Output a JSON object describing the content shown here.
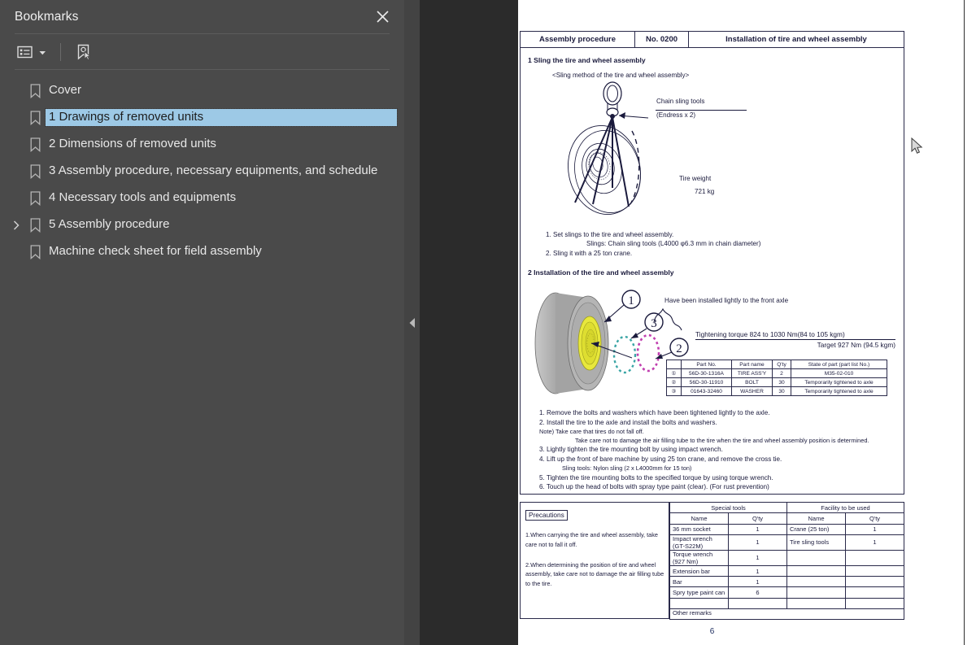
{
  "sidebar": {
    "title": "Bookmarks",
    "close_icon": "close-icon",
    "toolbar": {
      "options_label": "list-options-dropdown",
      "new_bookmark_label": "new-bookmark-icon"
    },
    "items": [
      {
        "label": "Cover",
        "selected": false,
        "expandable": false
      },
      {
        "label": "1 Drawings of removed units",
        "selected": true,
        "expandable": false
      },
      {
        "label": "2 Dimensions of removed units",
        "selected": false,
        "expandable": false
      },
      {
        "label": "3 Assembly procedure, necessary equipments, and schedule",
        "selected": false,
        "expandable": false
      },
      {
        "label": "4 Necessary tools and equipments",
        "selected": false,
        "expandable": false
      },
      {
        "label": "5 Assembly procedure",
        "selected": false,
        "expandable": true
      },
      {
        "label": "Machine check sheet for field assembly",
        "selected": false,
        "expandable": false
      }
    ]
  },
  "panel": {
    "collapse_handle": "collapse-panel-arrow"
  },
  "document": {
    "header": {
      "col1": "Assembly procedure",
      "col2": "No. 0200",
      "col3": "Installation of tire and wheel assembly"
    },
    "section1": {
      "title": "1 Sling the tire and wheel assembly",
      "subtitle": "<Sling method of the tire and wheel assembly>",
      "callout_chain": "Chain sling tools",
      "callout_chain2": "(Endress x 2)",
      "tire_weight_label": "Tire weight",
      "tire_weight_value": "721 kg",
      "steps": [
        "1. Set slings to the tire and wheel assembly.",
        "Slings: Chain sling tools (L4000 φ6.3 mm in chain diameter)",
        "2. Sling it with a 25 ton crane."
      ]
    },
    "section2": {
      "title": "2 Installation of the tire and wheel assembly",
      "axle_note": "Have been installed lightly to the front axle",
      "torque_line1": "Tightening torque 824 to 1030 Nm(84 to 105 kgm)",
      "torque_line2": "Target 927 Nm (94.5 kgm)",
      "balloons": [
        "①",
        "③",
        "②"
      ],
      "parts_table": {
        "headers": [
          "",
          "Part No.",
          "Part name",
          "Q'ty",
          "State of part (part list No.)"
        ],
        "rows": [
          [
            "①",
            "56D-30-1316A",
            "TIRE ASS'Y",
            "2",
            "M35-02-010"
          ],
          [
            "②",
            "56D-30-11910",
            "BOLT",
            "30",
            "Temporarily tightened to axle"
          ],
          [
            "③",
            "01643-32460",
            "WASHER",
            "30",
            "Temporarily tightened to axle"
          ]
        ]
      },
      "steps": [
        "1. Remove the bolts and washers which have been tightened lightly to the axle.",
        "2. Install the tire to the axle and install the bolts and washers.",
        "Note) Take care that tires do not fall off.",
        "Take care not to damage the air filling tube to the tire when the tire and wheel assembly position is determined.",
        "3. Lightly tighten the tire mounting bolt by using impact wrench.",
        "4. Lift up the front of bare machine by using 25 ton crane, and remove the cross tie.",
        "Sling tools: Nylon sling (2 x L4000mm for 15 ton)",
        "5. Tighten the tire mounting bolts to the specified torque by using torque wrench.",
        "6. Touch up the head of bolts with spray type paint (clear). (For rust prevention)"
      ]
    },
    "footer": {
      "precautions_label": "Precautions",
      "precaution1": "1.When carrying the tire and wheel assembly, take care not to fall it off.",
      "precaution2": "2.When determining the position of tire and wheel assembly, take care not to damage the air filling tube to the tire.",
      "special_tools_title": "Special tools",
      "facility_title": "Facility to be used",
      "col_name": "Name",
      "col_qty": "Q'ty",
      "special_tools": [
        {
          "name": "36 mm socket",
          "qty": "1"
        },
        {
          "name": "Impact wrench (GT-S22M)",
          "qty": "1"
        },
        {
          "name": "Torque wrench (927 Nm)",
          "qty": "1"
        },
        {
          "name": "Extension bar",
          "qty": "1"
        },
        {
          "name": "Bar",
          "qty": "1"
        },
        {
          "name": "Spry type paint can",
          "qty": "6"
        },
        {
          "name": "",
          "qty": ""
        }
      ],
      "facility": [
        {
          "name": "Crane (25 ton)",
          "qty": "1"
        },
        {
          "name": "Tire sling tools",
          "qty": "1"
        },
        {
          "name": "",
          "qty": ""
        },
        {
          "name": "",
          "qty": ""
        },
        {
          "name": "",
          "qty": ""
        },
        {
          "name": "",
          "qty": ""
        },
        {
          "name": "",
          "qty": ""
        }
      ],
      "other_remarks": "Other remarks",
      "page_number": "6"
    }
  },
  "colors": {
    "sidebar_bg": "#4a4a4a",
    "viewer_bg": "#2b2b2b",
    "selection": "#9dc9e6",
    "doc_ink": "#1a1a3c"
  }
}
